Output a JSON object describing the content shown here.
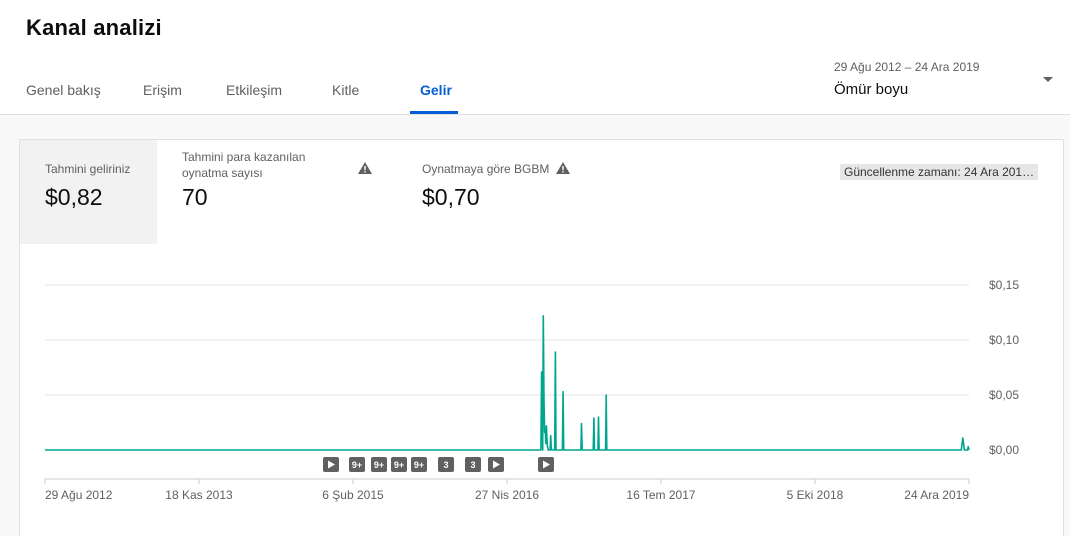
{
  "page": {
    "title": "Kanal analizi"
  },
  "tabs": [
    {
      "label": "Genel bakış",
      "active": false
    },
    {
      "label": "Erişim",
      "active": false
    },
    {
      "label": "Etkileşim",
      "active": false
    },
    {
      "label": "Kitle",
      "active": false
    },
    {
      "label": "Gelir",
      "active": true
    }
  ],
  "period_selector": {
    "range": "29 Ağu 2012 – 24 Ara 2019",
    "value": "Ömür boyu",
    "icon": "caret-down-icon"
  },
  "metrics": {
    "revenue": {
      "label": "Tahmini geliriniz",
      "value": "$0,82",
      "selected": true
    },
    "monetized_playbacks": {
      "label_line1": "Tahmini para kazanılan",
      "label_line2": "oynatma sayısı",
      "value": "70",
      "icon": "warning-icon"
    },
    "cpm": {
      "label": "Oynatmaya göre BGBM",
      "value": "$0,70",
      "icon": "warning-icon"
    }
  },
  "updated_badge": "Güncellenme zamanı: 24 Ara 201…",
  "colors": {
    "accent": "#065fd4",
    "line": "#00a58e",
    "marker_bg": "#606060"
  },
  "chart_data": {
    "type": "line",
    "xlabels": [
      "29 Ağu 2012",
      "18 Kas 2013",
      "6 Şub 2015",
      "27 Nis 2016",
      "16 Tem 2017",
      "5 Eki 2018",
      "24 Ara 2019"
    ],
    "ytick_labels": [
      "$0,15",
      "$0,10",
      "$0,05",
      "$0,00"
    ],
    "yticks": [
      0.15,
      0.1,
      0.05,
      0.0
    ],
    "ylim": [
      0,
      0.15
    ],
    "grid": true,
    "series": [
      {
        "x_index_range": [
          0,
          6
        ],
        "points": [
          [
            0,
            0
          ],
          [
            3.22,
            0
          ],
          [
            3.225,
            0.071
          ],
          [
            3.228,
            0.015
          ],
          [
            3.232,
            0
          ],
          [
            3.236,
            0.122
          ],
          [
            3.24,
            0.045
          ],
          [
            3.244,
            0.016
          ],
          [
            3.248,
            0.02
          ],
          [
            3.252,
            0.006
          ],
          [
            3.256,
            0.022
          ],
          [
            3.262,
            0.004
          ],
          [
            3.268,
            0
          ],
          [
            3.28,
            0
          ],
          [
            3.284,
            0.013
          ],
          [
            3.288,
            0
          ],
          [
            3.31,
            0
          ],
          [
            3.314,
            0.089
          ],
          [
            3.318,
            0
          ],
          [
            3.36,
            0
          ],
          [
            3.364,
            0.053
          ],
          [
            3.368,
            0
          ],
          [
            3.48,
            0
          ],
          [
            3.484,
            0.024
          ],
          [
            3.488,
            0
          ],
          [
            3.56,
            0
          ],
          [
            3.564,
            0.029
          ],
          [
            3.568,
            0
          ],
          [
            3.59,
            0
          ],
          [
            3.594,
            0.03
          ],
          [
            3.598,
            0
          ],
          [
            3.64,
            0
          ],
          [
            3.644,
            0.05
          ],
          [
            3.648,
            0
          ],
          [
            5.95,
            0
          ],
          [
            5.96,
            0.011
          ],
          [
            5.97,
            0
          ],
          [
            5.99,
            0
          ],
          [
            5.995,
            0.003
          ],
          [
            6,
            0
          ]
        ]
      }
    ],
    "annotations": [
      "play",
      "9+",
      "9+",
      "9+",
      "9+",
      "3",
      "3",
      "play",
      "play"
    ]
  }
}
